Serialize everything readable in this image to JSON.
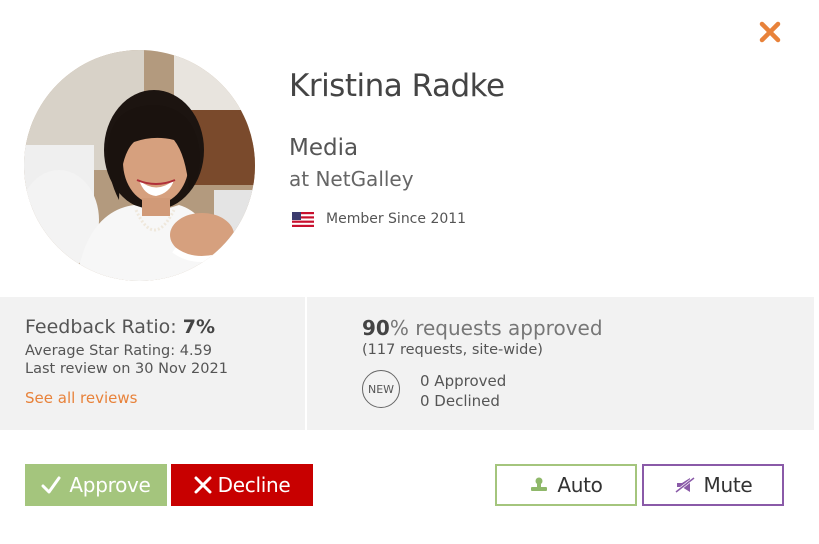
{
  "profile": {
    "name": "Kristina Radke",
    "role": "Media",
    "organization": "at NetGalley",
    "member_since": "Member Since 2011",
    "country_flag_icon": "us-flag-icon"
  },
  "feedback": {
    "label": "Feedback Ratio:",
    "ratio": "7%",
    "average_rating": "Average Star Rating: 4.59",
    "last_review": "Last review on 30 Nov 2021",
    "see_all_link": "See all reviews"
  },
  "requests": {
    "percent": "90",
    "approved_text": "% requests approved",
    "subtitle": "(117 requests, site-wide)",
    "new_badge": "NEW",
    "approved_count": "0 Approved",
    "declined_count": "0 Declined"
  },
  "actions": {
    "approve_label": "Approve",
    "decline_label": "Decline",
    "auto_label": "Auto",
    "mute_label": "Mute"
  },
  "colors": {
    "accent_orange": "#e8823a",
    "approve_green": "#a4c57d",
    "decline_red": "#c80000",
    "mute_purple": "#8a5aa8",
    "panel_gray": "#f2f2f2"
  }
}
